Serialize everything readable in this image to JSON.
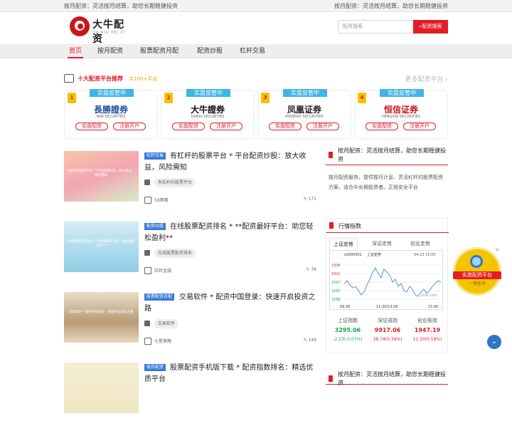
{
  "topbar": {
    "left": "按月配资：灵活按月结算，助您长期稳健投资",
    "right": "按月配资：灵活按月结算，助您长期稳健投资"
  },
  "logo": {
    "cn": "大牛配资",
    "en": "DA NIU PEI ZI"
  },
  "search": {
    "placeholder": "配资搜索",
    "button": "配资搜索"
  },
  "nav": [
    "首页",
    "按月配资",
    "股票配资月配",
    "配资炒股",
    "杠杆交易"
  ],
  "rec": {
    "title": "十大配资平台推荐",
    "sub": "共100+平台",
    "more": "更多配资平台"
  },
  "cards": [
    {
      "num": "1",
      "ribbon": "实盘监管中",
      "brand": "長勝證券",
      "en": "WIN SECURITIES",
      "b1": "实盘配资",
      "b2": "注册开户",
      "color": "#1e4fa0"
    },
    {
      "num": "2",
      "ribbon": "实盘监管中",
      "brand": "大牛證券",
      "en": "DANIU SECURITIES",
      "b1": "实盘配资",
      "b2": "注册开户",
      "color": "#111111"
    },
    {
      "num": "3",
      "ribbon": "实盘监管中",
      "brand": "凤凰证券",
      "en": "PHOENIX SECURITIES",
      "b1": "实盘配资",
      "b2": "注册开户",
      "color": "#222222"
    },
    {
      "num": "4",
      "ribbon": "实盘监管中",
      "brand": "恒信证券",
      "en": "HENGXIN SECURITIES",
      "b1": "实盘配资",
      "b2": "注册开户",
      "color": "#c8161d"
    }
  ],
  "articles": [
    {
      "tag": "杠杆交易",
      "title": "有杠杆的股票平台 * 平台配资炒股：放大收益，风险需知",
      "kw": "有杠杆的股票平台",
      "author": "58策略",
      "views": "171",
      "thumb": "有杠杆的股票平台 * 平台配资炒股：放大收益，风险需知"
    },
    {
      "tag": "配资炒股",
      "title": "在线股票配资排名 * **配资最好平台：助您轻松盈利**",
      "kw": "在线股票配资排名",
      "author": "红岭金服",
      "views": "76",
      "thumb": "在线股票配资排名 * **配资最好平台：助您轻松盈利**"
    },
    {
      "tag": "股票配资月配",
      "title": "交易软件 * 配资中国登录：快速开启投资之路",
      "kw": "交易软件",
      "author": "七星策略",
      "views": "149",
      "thumb": "交易软件 * 配资中国登录：快速开启投资之路"
    },
    {
      "tag": "按月配资",
      "title": "股票配资手机版下载 * 配资指数排名：精选优质平台",
      "kw": "",
      "author": "",
      "views": "",
      "thumb": ""
    }
  ],
  "side1": {
    "title": "按月配资：灵活按月结算，助您长期稳健投资",
    "body": "按月配资服务，提供按月计息、灵活杠杆的股票配资方案，适合中长期投资者。正规安全平台"
  },
  "market": {
    "title": "行情指数",
    "tabs": [
      "上证走势",
      "深证走势",
      "创业走势"
    ],
    "chart_code": "sh000001",
    "chart_name": "上证走势",
    "chart_date": "04-25 15:00",
    "yticks": [
      "3306",
      "3301",
      "3297",
      "3293",
      "3289"
    ],
    "xticks": [
      "09:30",
      "11:30/13:00",
      "15:00"
    ],
    "watermark": "sina.com",
    "indices": [
      {
        "name": "上证指数",
        "value": "3295.06",
        "change": "-2.23(-0.07%)",
        "color": "#1aa34a"
      },
      {
        "name": "深证成指",
        "value": "9917.06",
        "change": "38.74(0.39%)",
        "color": "#e11e24"
      },
      {
        "name": "创业板指",
        "value": "1947.19",
        "change": "11.33(0.59%)",
        "color": "#e11e24"
      }
    ]
  },
  "side2": {
    "title": "按月配资：灵活按月结算，助您长期稳健投资"
  },
  "float": {
    "label": "实盘配资平台",
    "sub": "一键查询",
    "close": "×"
  },
  "totop": "⌄"
}
